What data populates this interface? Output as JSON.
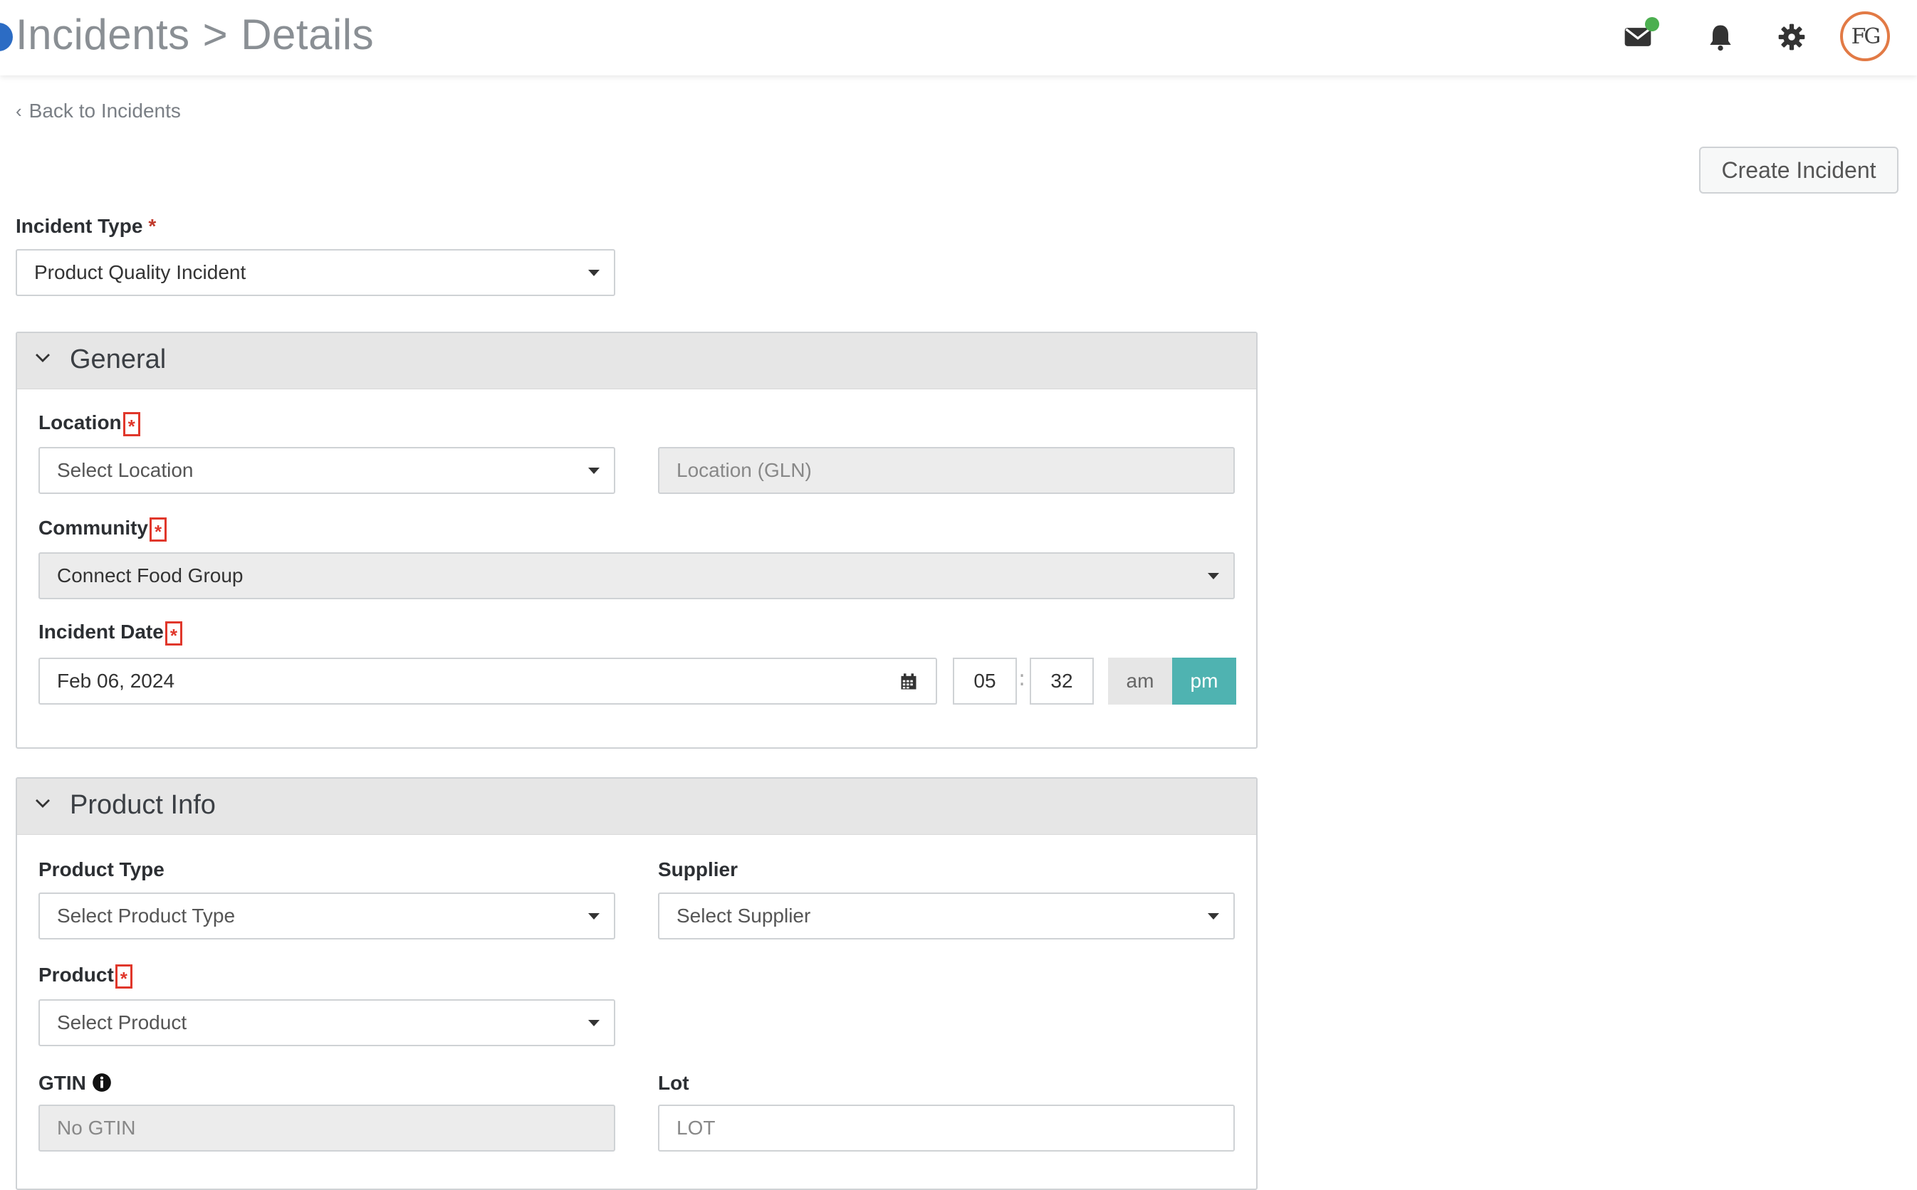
{
  "header": {
    "breadcrumb": {
      "section": "Incidents",
      "separator": ">",
      "current": "Details"
    },
    "icons": {
      "mail": "mail-icon",
      "bell": "bell-icon",
      "settings": "gear-icon"
    },
    "avatar_initials": "FG",
    "colors": {
      "mail_badge": "#4caf50",
      "avatar_ring": "#e27a45"
    }
  },
  "back_link": "Back to Incidents",
  "actions": {
    "create_incident": "Create Incident"
  },
  "incident_type": {
    "label": "Incident Type",
    "required_marker": "*",
    "value": "Product Quality Incident"
  },
  "general": {
    "title": "General",
    "location": {
      "label": "Location",
      "required_marker": "*",
      "placeholder": "Select Location",
      "gln_placeholder": "Location (GLN)"
    },
    "community": {
      "label": "Community",
      "required_marker": "*",
      "value": "Connect Food Group"
    },
    "incident_date": {
      "label": "Incident Date",
      "required_marker": "*",
      "date": "Feb 06, 2024",
      "hour": "05",
      "time_separator": ":",
      "minute": "32",
      "am_label": "am",
      "pm_label": "pm",
      "selected_period": "pm"
    }
  },
  "product_info": {
    "title": "Product Info",
    "product_type": {
      "label": "Product Type",
      "placeholder": "Select Product Type"
    },
    "supplier": {
      "label": "Supplier",
      "placeholder": "Select Supplier"
    },
    "product": {
      "label": "Product",
      "required_marker": "*",
      "placeholder": "Select Product"
    },
    "gtin": {
      "label": "GTIN",
      "value": "No GTIN"
    },
    "lot": {
      "label": "Lot",
      "placeholder": "LOT"
    }
  },
  "accent_color": "#4fb3b1",
  "required_highlight_color": "#e0372b"
}
